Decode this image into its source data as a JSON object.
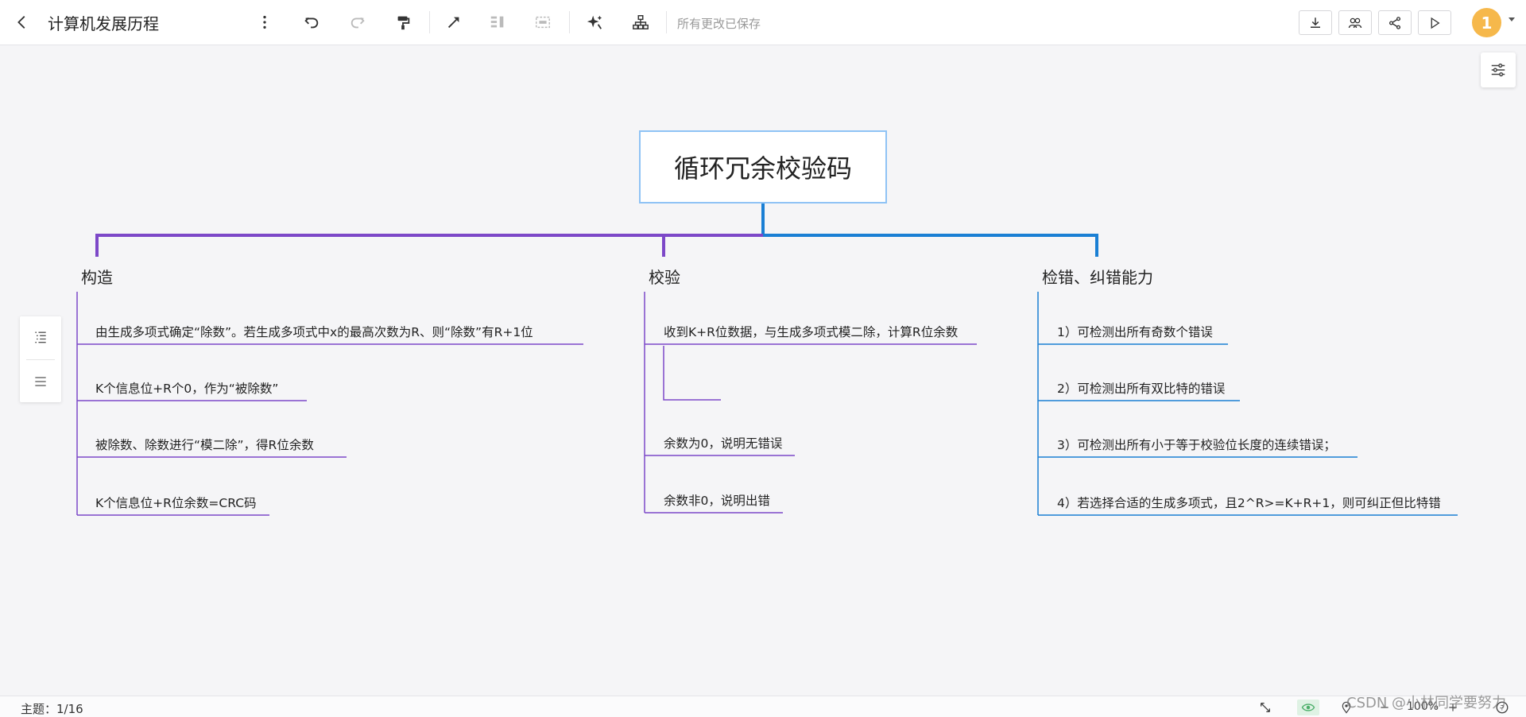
{
  "toolbar": {
    "doc_title": "计算机发展历程",
    "save_status": "所有更改已保存",
    "avatar_label": "1"
  },
  "mindmap": {
    "root": "循环冗余校验码",
    "branches": [
      {
        "label": "构造",
        "color": "#7d48c8",
        "items": [
          "由生成多项式确定“除数”。若生成多项式中x的最高次数为R、则“除数”有R+1位",
          "K个信息位+R个0，作为“被除数”",
          "被除数、除数进行“模二除”，得R位余数",
          "K个信息位+R位余数=CRC码"
        ]
      },
      {
        "label": "校验",
        "color": "#7d48c8",
        "items": [
          "收到K+R位数据，与生成多项式模二除，计算R位余数",
          "",
          "余数为0，说明无错误",
          "余数非0，说明出错"
        ]
      },
      {
        "label": "检错、纠错能力",
        "color": "#1a7fd4",
        "items": [
          "1）可检测出所有奇数个错误",
          "2）可检测出所有双比特的错误",
          "3）可检测出所有小于等于校验位长度的连续错误；",
          "4）若选择合适的生成多项式，且2^R>=K+R+1，则可纠正但比特错"
        ]
      }
    ]
  },
  "status": {
    "topic_count": "主题：1/16",
    "zoom": "100%"
  },
  "watermark": "CSDN @小林同学要努力"
}
